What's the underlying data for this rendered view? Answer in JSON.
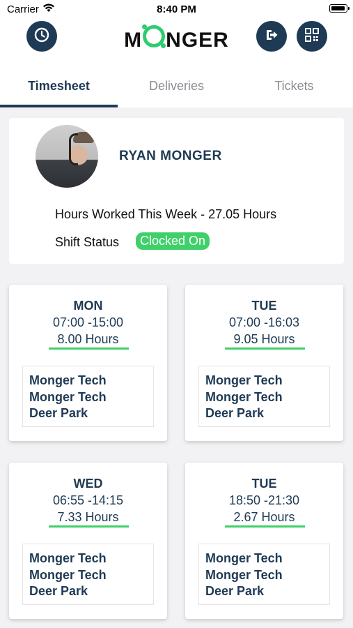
{
  "status": {
    "carrier": "Carrier",
    "time": "8:40 PM"
  },
  "header": {
    "logo": "MONGER",
    "logo_left": "M",
    "logo_right": "NGER"
  },
  "tabs": [
    {
      "label": "Timesheet",
      "active": true
    },
    {
      "label": "Deliveries",
      "active": false
    },
    {
      "label": "Tickets",
      "active": false
    }
  ],
  "profile": {
    "name": "RYAN MONGER",
    "hours_text": "Hours Worked This Week - 27.05 Hours",
    "shift_label": "Shift Status",
    "shift_status": "Clocked On"
  },
  "days": [
    {
      "day": "MON",
      "time": "07:00 -15:00",
      "hours": "8.00 Hours",
      "loc1": "Monger Tech",
      "loc2": "Monger Tech",
      "loc3": "Deer Park"
    },
    {
      "day": "TUE",
      "time": "07:00 -16:03",
      "hours": "9.05 Hours",
      "loc1": "Monger Tech",
      "loc2": "Monger Tech",
      "loc3": "Deer Park"
    },
    {
      "day": "WED",
      "time": "06:55 -14:15",
      "hours": "7.33 Hours",
      "loc1": "Monger Tech",
      "loc2": "Monger Tech",
      "loc3": "Deer Park"
    },
    {
      "day": "TUE",
      "time": "18:50 -21:30",
      "hours": "2.67 Hours",
      "loc1": "Monger Tech",
      "loc2": "Monger Tech",
      "loc3": "Deer Park"
    }
  ],
  "colors": {
    "primary": "#1f3a55",
    "accent": "#3fd06a",
    "background": "#f2f2f4"
  },
  "icons": [
    "clock-icon",
    "logout-icon",
    "qr-code-icon",
    "wifi-icon",
    "battery-icon"
  ]
}
